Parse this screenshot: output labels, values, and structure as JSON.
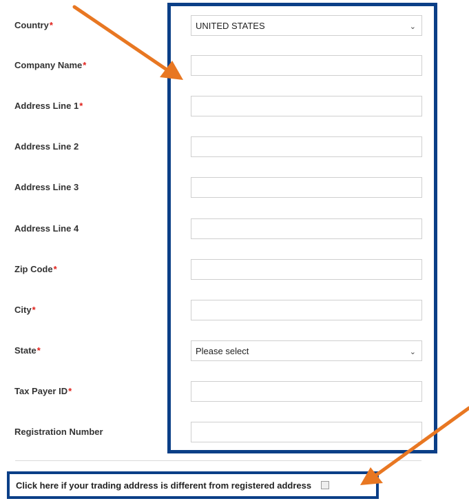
{
  "form": {
    "country": {
      "label": "Country",
      "required_mark": "*",
      "value": "UNITED STATES",
      "chevron_icon": "chevron-down-icon"
    },
    "company_name": {
      "label": "Company Name",
      "required_mark": "*",
      "value": ""
    },
    "address_line_1": {
      "label": "Address Line 1",
      "required_mark": "*",
      "value": ""
    },
    "address_line_2": {
      "label": "Address Line 2",
      "value": ""
    },
    "address_line_3": {
      "label": "Address Line 3",
      "value": ""
    },
    "address_line_4": {
      "label": "Address Line 4",
      "value": ""
    },
    "zip_code": {
      "label": "Zip Code",
      "required_mark": "*",
      "value": ""
    },
    "city": {
      "label": "City",
      "required_mark": "*",
      "value": ""
    },
    "state": {
      "label": "State",
      "required_mark": "*",
      "value": "Please select",
      "chevron_icon": "chevron-down-icon"
    },
    "tax_payer_id": {
      "label": "Tax Payer ID",
      "required_mark": "*",
      "value": ""
    },
    "registration_number": {
      "label": "Registration Number",
      "value": ""
    }
  },
  "trading_address": {
    "label": "Click here if your trading address is different from registered address",
    "checked": false
  },
  "annotations": {
    "highlight_color": "#0b3f87",
    "arrow_color": "#e87722"
  }
}
